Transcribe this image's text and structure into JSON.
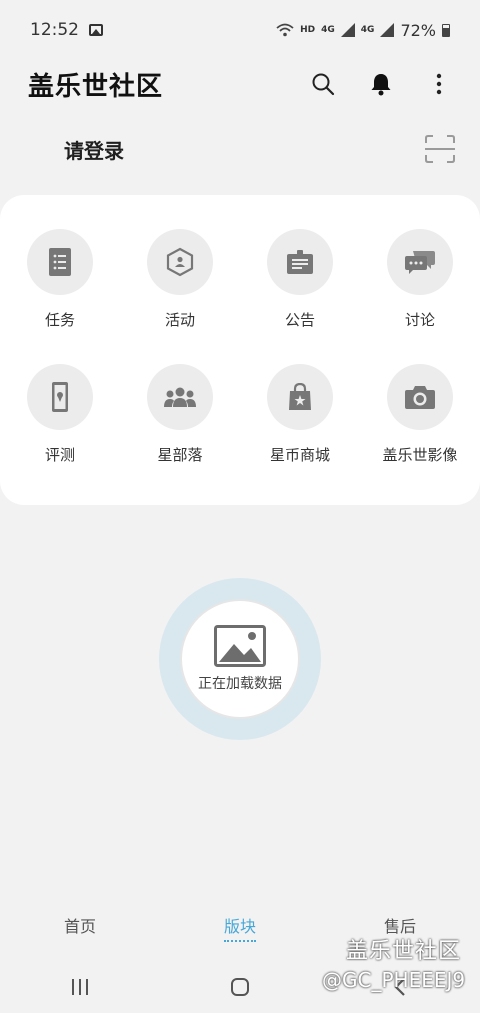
{
  "status_bar": {
    "time": "12:52",
    "network_hd": "HD",
    "network_4g": "4G",
    "battery": "72%"
  },
  "header": {
    "title": "盖乐世社区",
    "icons": [
      "search-icon",
      "bell-icon",
      "more-vertical-icon"
    ]
  },
  "login": {
    "label": "请登录",
    "scan_icon": "scan-icon"
  },
  "grid": {
    "items": [
      {
        "label": "任务",
        "icon": "task-list-icon"
      },
      {
        "label": "活动",
        "icon": "activity-hexagon-icon"
      },
      {
        "label": "公告",
        "icon": "announcement-board-icon"
      },
      {
        "label": "讨论",
        "icon": "discussion-chat-icon"
      },
      {
        "label": "评测",
        "icon": "phone-review-icon"
      },
      {
        "label": "星部落",
        "icon": "group-people-icon"
      },
      {
        "label": "星币商城",
        "icon": "shopping-bag-star-icon"
      },
      {
        "label": "盖乐世影像",
        "icon": "camera-icon"
      }
    ]
  },
  "loading": {
    "text": "正在加载数据",
    "icon": "image-placeholder-icon"
  },
  "tabs": [
    {
      "label": "首页",
      "active": false
    },
    {
      "label": "版块",
      "active": true
    },
    {
      "label": "售后",
      "active": false
    }
  ],
  "watermark": {
    "line1": "盖乐世社区",
    "line2": "@GC_PHEEEJ9"
  },
  "colors": {
    "accent": "#47a8d8",
    "background": "#f2f2f2",
    "card": "#ffffff",
    "icon_circle": "#ececec",
    "loader_ring": "#d9e8ef"
  }
}
